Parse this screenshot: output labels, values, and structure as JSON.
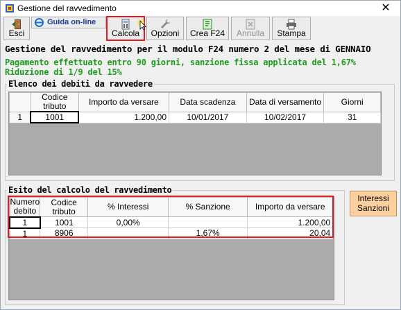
{
  "window": {
    "title": "Gestione del ravvedimento",
    "close_glyph": "✕"
  },
  "toolbar": {
    "esci": "Esci",
    "guida": "Guida on-line",
    "calcola": "Calcola",
    "opzioni": "Opzioni",
    "crea_f24": "Crea F24",
    "annulla": "Annulla",
    "stampa": "Stampa"
  },
  "header": {
    "title": "Gestione del ravvedimento per il modulo F24 numero 2 del mese di GENNAIO",
    "note1": "Pagamento effettuato entro 90 giorni, sanzione fissa applicata del 1,67%",
    "note2": "Riduzione di 1/9 del 15%"
  },
  "debiti": {
    "label": "Elenco dei debiti da ravvedere",
    "columns": [
      "",
      "Codice\ntributo",
      "Importo da versare",
      "Data scadenza",
      "Data di versamento",
      "Giorni"
    ],
    "rows": [
      {
        "n": "1",
        "codice": "1001",
        "importo": "1.200,00",
        "scadenza": "10/01/2017",
        "versamento": "10/02/2017",
        "giorni": "31"
      }
    ]
  },
  "esito": {
    "label": "Esito del calcolo del ravvedimento",
    "columns": [
      "Numero\ndebito",
      "Codice\ntributo",
      "% Interessi",
      "% Sanzione",
      "Importo da versare"
    ],
    "rows": [
      {
        "numero": "1",
        "codice": "1001",
        "interessi": "0,00%",
        "sanzione": "",
        "importo": "1.200,00"
      },
      {
        "numero": "1",
        "codice": "8906",
        "interessi": "",
        "sanzione": "1,67%",
        "importo": "20,04"
      }
    ]
  },
  "side_button": {
    "label_line1": "Interessi",
    "label_line2": "Sanzioni"
  },
  "colors": {
    "highlight": "#e01b24",
    "green_text": "#1d9a1d",
    "side_button": "#fbd09e"
  }
}
